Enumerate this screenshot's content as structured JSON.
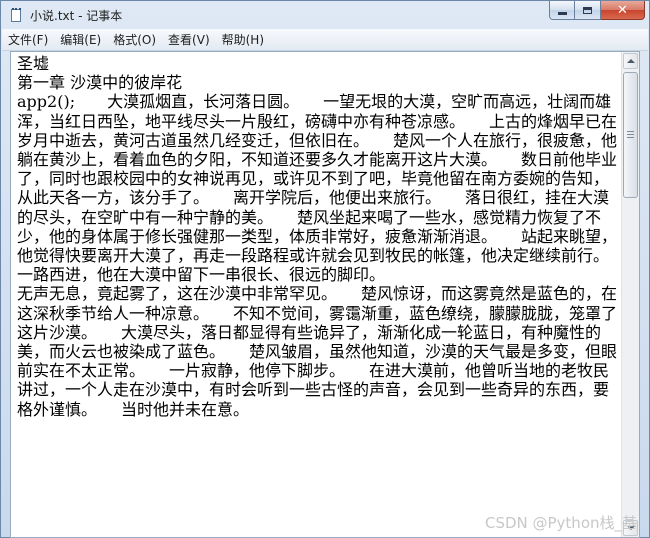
{
  "window": {
    "title": "小说.txt - 记事本"
  },
  "menu": {
    "items": [
      "文件(F)",
      "编辑(E)",
      "格式(O)",
      "查看(V)",
      "帮助(H)"
    ]
  },
  "document": {
    "content": "圣墟\n第一章 沙漠中的彼岸花\napp2();　　大漠孤烟直，长河落日圆。　　一望无垠的大漠，空旷而高远，壮阔而雄浑，当红日西坠，地平线尽头一片殷红，磅礴中亦有种苍凉感。　　上古的烽烟早已在岁月中逝去，黄河古道虽然几经变迁，但依旧在。　　楚风一个人在旅行，很疲惫，他躺在黄沙上，看着血色的夕阳，不知道还要多久才能离开这片大漠。　　数日前他毕业了，同时也跟校园中的女神说再见，或许见不到了吧，毕竟他留在南方委婉的告知，从此天各一方，该分手了。　　离开学院后，他便出来旅行。　　落日很红，挂在大漠的尽头，在空旷中有一种宁静的美。　　楚风坐起来喝了一些水，感觉精力恢复了不少，他的身体属于修长强健那一类型，体质非常好，疲惫渐渐消退。　　站起来眺望，他觉得快要离开大漠了，再走一段路程或许就会见到牧民的帐篷，他决定继续前行。　　一路西进，他在大漠中留下一串很长、很远的脚印。\n无声无息，竟起雾了，这在沙漠中非常罕见。　　楚风惊讶，而这雾竟然是蓝色的，在这深秋季节给人一种凉意。　　不知不觉间，雾霭渐重，蓝色缭绕，朦朦胧胧，笼罩了这片沙漠。　　大漠尽头，落日都显得有些诡异了，渐渐化成一轮蓝日，有种魔性的美，而火云也被染成了蓝色。　　楚风皱眉，虽然他知道，沙漠的天气最是多变，但眼前实在不太正常。　　一片寂静，他停下脚步。　　在进大漠前，他曾听当地的老牧民讲过，一个人走在沙漠中，有时会听到一些古怪的声音，会见到一些奇异的东西，要格外谨慎。　　当时他并未在意。"
  },
  "watermark": {
    "text": "CSDN @Python栈_基"
  }
}
